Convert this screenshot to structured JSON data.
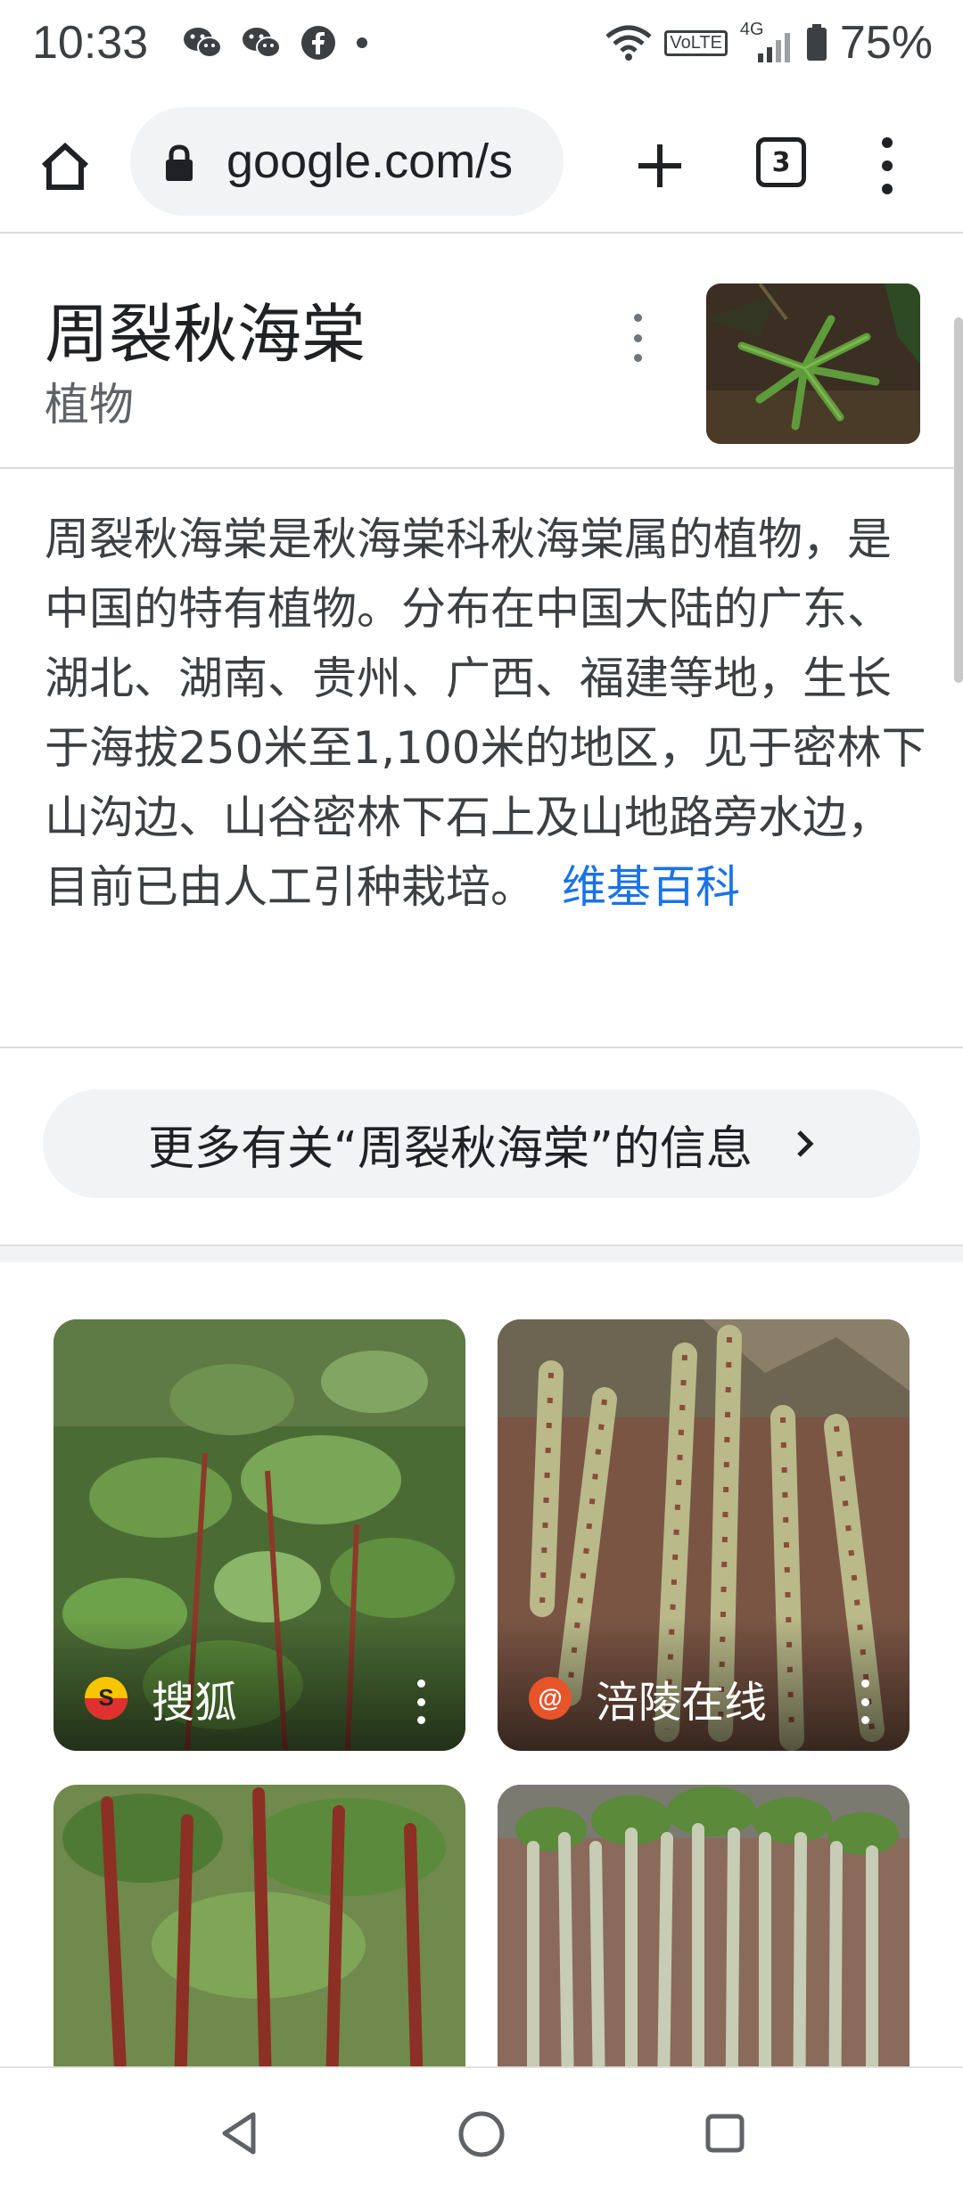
{
  "status_bar": {
    "time": "10:33",
    "battery": "75%",
    "network_label": "4G",
    "volte_label": "VoLTE",
    "notification_icons": [
      "wechat-icon",
      "wechat-icon",
      "facebook-icon",
      "dot-icon"
    ]
  },
  "toolbar": {
    "url": "google.com/s",
    "tab_count": "3"
  },
  "knowledge_panel": {
    "title": "周裂秋海棠",
    "subtitle": "植物",
    "description": "周裂秋海棠是秋海棠科秋海棠属的植物，是中国的特有植物。分布在中国大陆的广东、湖北、湖南、贵州、广西、福建等地，生长于海拔250米至1,100米的地区，见于密林下山沟边、山谷密林下石上及山地路旁水边，目前已由人工引种栽培。",
    "source_link": "维基百科"
  },
  "more_info": {
    "label": "更多有关“周裂秋海棠”的信息"
  },
  "images": [
    {
      "source": "搜狐",
      "icon": "sohu-icon"
    },
    {
      "source": "涪陵在线",
      "icon": "fuling-icon"
    },
    {
      "source": "",
      "icon": ""
    },
    {
      "source": "",
      "icon": ""
    }
  ],
  "colors": {
    "link": "#1a73e8",
    "chip_bg": "#f1f3f4",
    "divider": "#dadce0"
  }
}
